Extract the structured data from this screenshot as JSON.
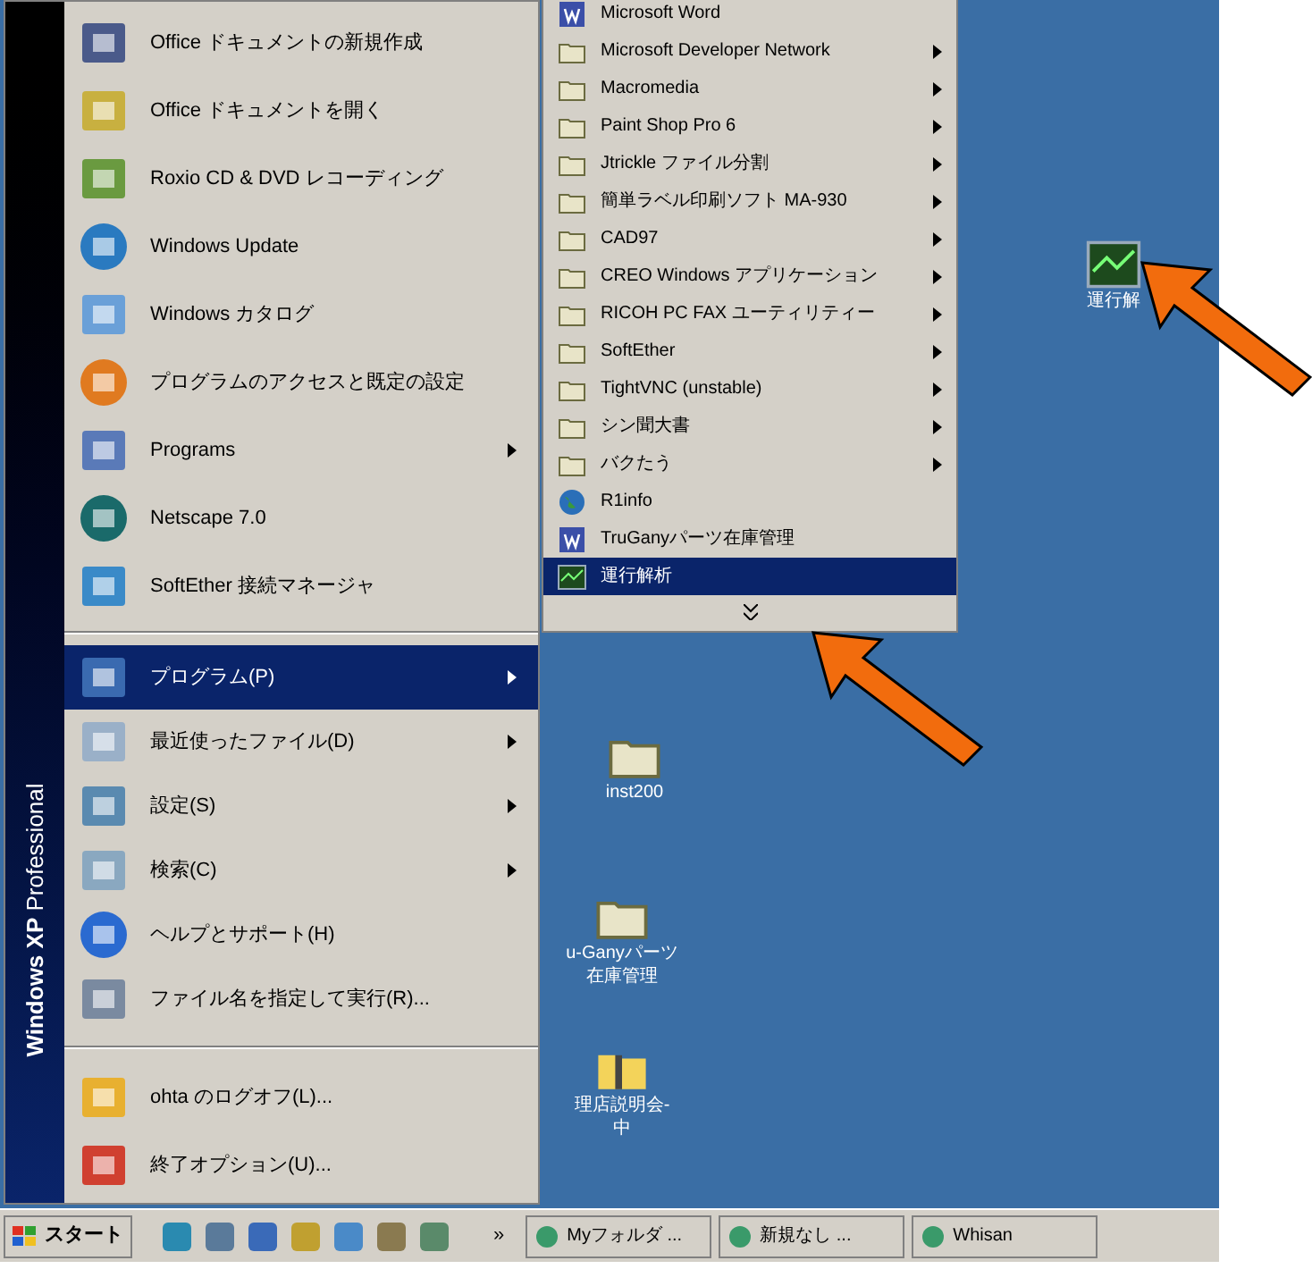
{
  "start_menu": {
    "band_text": "**Windows XP** Professional",
    "top_items": [
      {
        "label": "Office ドキュメントの新規作成",
        "has_submenu": false,
        "selected": false
      },
      {
        "label": "Office ドキュメントを開く",
        "has_submenu": false,
        "selected": false
      },
      {
        "label": "Roxio CD & DVD レコーディング",
        "has_submenu": false,
        "selected": false
      },
      {
        "label": "Windows Update",
        "has_submenu": false,
        "selected": false
      },
      {
        "label": "Windows カタログ",
        "has_submenu": false,
        "selected": false
      },
      {
        "label": "プログラムのアクセスと既定の設定",
        "has_submenu": false,
        "selected": false
      },
      {
        "label": "Programs",
        "has_submenu": true,
        "selected": false
      },
      {
        "label": "Netscape 7.0",
        "has_submenu": false,
        "selected": false
      },
      {
        "label": "SoftEther 接続マネージャ",
        "has_submenu": false,
        "selected": false
      }
    ],
    "main_items": [
      {
        "label": "プログラム(P)",
        "has_submenu": true,
        "selected": true
      },
      {
        "label": "最近使ったファイル(D)",
        "has_submenu": true,
        "selected": false
      },
      {
        "label": "設定(S)",
        "has_submenu": true,
        "selected": false
      },
      {
        "label": "検索(C)",
        "has_submenu": true,
        "selected": false
      },
      {
        "label": "ヘルプとサポート(H)",
        "has_submenu": false,
        "selected": false
      },
      {
        "label": "ファイル名を指定して実行(R)...",
        "has_submenu": false,
        "selected": false
      }
    ],
    "bottom_items": [
      {
        "label": "ohta のログオフ(L)...",
        "has_submenu": false,
        "selected": false
      },
      {
        "label": "終了オプション(U)...",
        "has_submenu": false,
        "selected": false
      }
    ]
  },
  "programs_menu": {
    "items": [
      {
        "label": "Microsoft Word",
        "kind": "app",
        "has_submenu": false,
        "selected": false
      },
      {
        "label": "Microsoft Developer Network",
        "kind": "folder",
        "has_submenu": true,
        "selected": false
      },
      {
        "label": "Macromedia",
        "kind": "folder",
        "has_submenu": true,
        "selected": false
      },
      {
        "label": "Paint Shop Pro 6",
        "kind": "folder",
        "has_submenu": true,
        "selected": false
      },
      {
        "label": "Jtrickle ファイル分割",
        "kind": "folder",
        "has_submenu": true,
        "selected": false
      },
      {
        "label": "簡単ラベル印刷ソフト MA-930",
        "kind": "folder",
        "has_submenu": true,
        "selected": false
      },
      {
        "label": "CAD97",
        "kind": "folder",
        "has_submenu": true,
        "selected": false
      },
      {
        "label": "CREO Windows アプリケーション",
        "kind": "folder",
        "has_submenu": true,
        "selected": false
      },
      {
        "label": "RICOH PC FAX ユーティリティー",
        "kind": "folder",
        "has_submenu": true,
        "selected": false
      },
      {
        "label": "SoftEther",
        "kind": "folder",
        "has_submenu": true,
        "selected": false
      },
      {
        "label": "TightVNC (unstable)",
        "kind": "folder",
        "has_submenu": true,
        "selected": false
      },
      {
        "label": "シン聞大書",
        "kind": "folder",
        "has_submenu": true,
        "selected": false
      },
      {
        "label": "バクたう",
        "kind": "folder",
        "has_submenu": true,
        "selected": false
      },
      {
        "label": "R1info",
        "kind": "globe",
        "has_submenu": false,
        "selected": false
      },
      {
        "label": "TruGanyパーツ在庫管理",
        "kind": "app",
        "has_submenu": false,
        "selected": false
      },
      {
        "label": "運行解析",
        "kind": "chart",
        "has_submenu": false,
        "selected": true
      }
    ]
  },
  "desktop_icons": [
    {
      "lines": [
        "運行解"
      ],
      "kind": "chart"
    },
    {
      "lines": [
        "inst200"
      ],
      "kind": "folder"
    },
    {
      "lines": [
        "u-Ganyパーツ",
        "在庫管理"
      ],
      "kind": "folder"
    },
    {
      "lines": [
        "理店説明会-",
        "中"
      ],
      "kind": "zip"
    }
  ],
  "taskbar": {
    "start_label": "スタート",
    "overflow": "»",
    "tasks": [
      {
        "label": "Myフォルダ ..."
      },
      {
        "label": "新規なし ..."
      },
      {
        "label": "Whisan"
      }
    ]
  }
}
